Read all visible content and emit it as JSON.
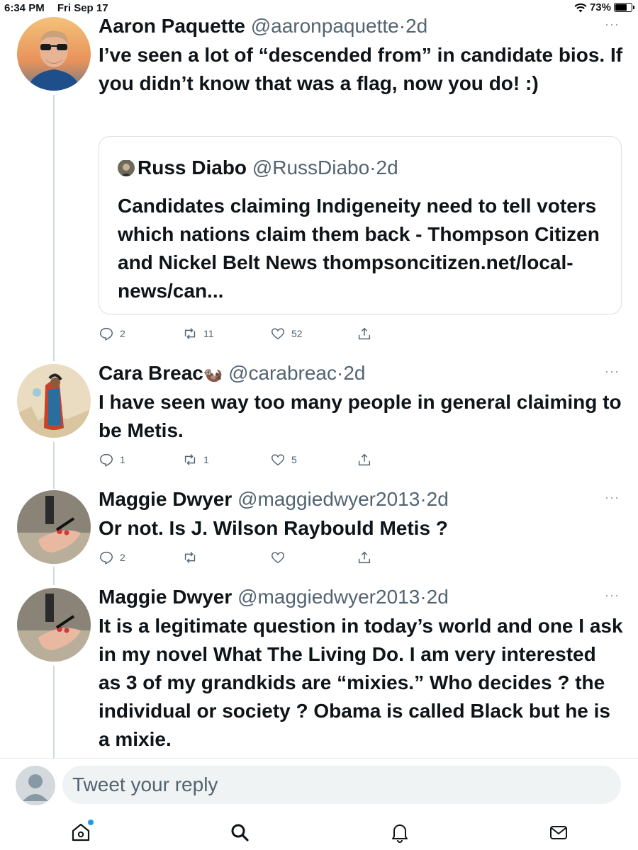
{
  "status_bar": {
    "time": "6:34 PM",
    "date": "Fri Sep 17",
    "battery": "73%",
    "battery_level": 0.73
  },
  "tweets": [
    {
      "name": "Aaron Paquette",
      "handle": "@aaronpaquette",
      "dot": "·",
      "time": "2d",
      "text": "I’ve seen a lot of “descended from” in candidate bios. If you didn’t know that was a flag, now you do! :)",
      "quote": {
        "name": "Russ Diabo",
        "handle": "@RussDiabo",
        "dot": "·",
        "time": "2d",
        "text": "Candidates claiming Indigeneity need to tell voters which nations claim them back - Thompson Citizen and Nickel Belt News thompsoncitizen.net/local-news/can..."
      },
      "replies": "2",
      "retweets": "11",
      "likes": "52"
    },
    {
      "name": "Cara Breac",
      "name_emoji": "🦦",
      "handle": "@carabreac",
      "dot": "·",
      "time": "2d",
      "text": "I have seen way too many people in general claiming to be Metis.",
      "replies": "1",
      "retweets": "1",
      "likes": "5"
    },
    {
      "name": "Maggie Dwyer",
      "handle": "@maggiedwyer2013",
      "dot": "·",
      "time": "2d",
      "text": "Or not. Is J. Wilson Raybould Metis ?",
      "replies": "2",
      "retweets": "",
      "likes": ""
    },
    {
      "name": "Maggie Dwyer",
      "handle": "@maggiedwyer2013",
      "dot": "·",
      "time": "2d",
      "text": "It is a legitimate question in today’s world and one I ask in my novel  What The Living Do. I am very interested as 3 of my grandkids are “mixies.” Who decides ? the individual or society ?  Obama is called Black but he is a mixie."
    }
  ],
  "more_label": "···",
  "reply": {
    "placeholder": "Tweet your reply"
  },
  "tabs": [
    {
      "icon": "home-icon"
    },
    {
      "icon": "search-icon"
    },
    {
      "icon": "notifications-icon"
    },
    {
      "icon": "messages-icon"
    }
  ],
  "colors": {
    "accent": "#1d9bf0",
    "secondary_text": "#536471",
    "thread_line": "#cfd9de"
  }
}
